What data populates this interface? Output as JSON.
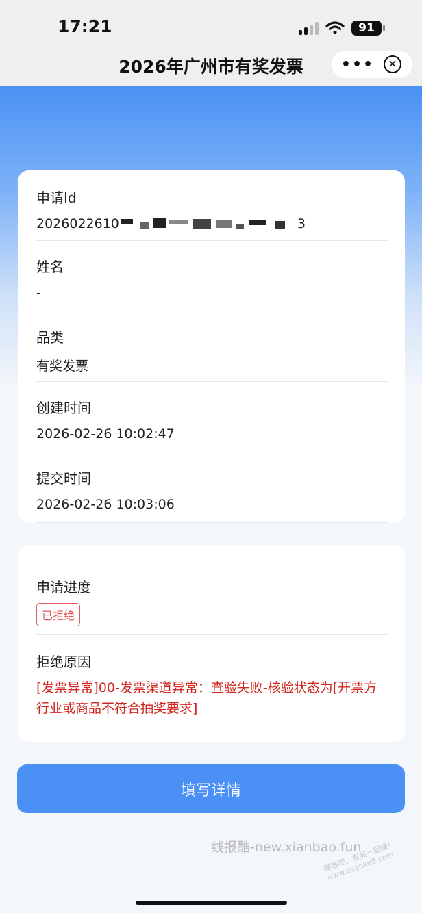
{
  "status_bar": {
    "time": "17:21",
    "battery": "91"
  },
  "nav": {
    "title": "2026年广州市有奖发票",
    "more_icon": "•••",
    "close_icon": "✕"
  },
  "details": {
    "application_id": {
      "label": "申请Id",
      "value_prefix": "2026022610",
      "value_suffix": "3"
    },
    "name": {
      "label": "姓名",
      "value": "-"
    },
    "category": {
      "label": "品类",
      "value": "有奖发票"
    },
    "created": {
      "label": "创建时间",
      "value": "2026-02-26 10:02:47"
    },
    "submitted": {
      "label": "提交时间",
      "value": "2026-02-26 10:03:06"
    }
  },
  "progress": {
    "label": "申请进度",
    "status_badge": "已拒绝",
    "reason_label": "拒绝原因",
    "reason_text": "[发票异常]00-发票渠道异常：查验失败-核验状态为[开票方行业或商品不符合抽奖要求]"
  },
  "actions": {
    "fill_details": "填写详情"
  },
  "watermark": {
    "main": "线报酷-new.xianbao.fun",
    "secondary": "赚客吧，有奖一起赚！www.zuanke8.com"
  },
  "colors": {
    "primary": "#4a90f5",
    "error": "#d0261e",
    "badge": "#e05a5a"
  }
}
